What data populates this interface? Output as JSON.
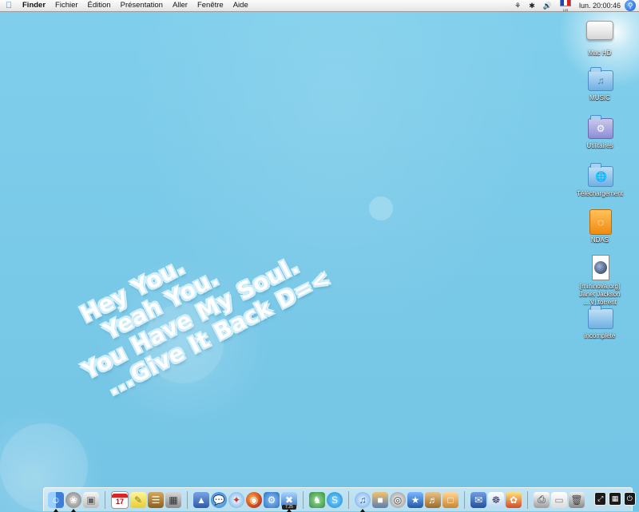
{
  "menubar": {
    "apple_glyph": "",
    "app_name": "Finder",
    "menus": [
      "Fichier",
      "Édition",
      "Présentation",
      "Aller",
      "Fenêtre",
      "Aide"
    ],
    "flag_label": "123",
    "clock": "lun. 20:00:46"
  },
  "desktop_icons": [
    {
      "label": "Mac HD",
      "icon": "hard-drive-icon"
    },
    {
      "label": "MUSIC",
      "icon": "music-folder-icon"
    },
    {
      "label": "Utilitaires",
      "icon": "utilities-folder-icon"
    },
    {
      "label": "Téléchargement",
      "icon": "download-folder-icon"
    },
    {
      "label": "NDAS",
      "icon": "ndas-drive-icon"
    },
    {
      "label": "[mininova.org] Janet Jackson ....V].torrent",
      "icon": "torrent-file-icon"
    },
    {
      "label": "incomplete",
      "icon": "folder-icon"
    }
  ],
  "wallpaper_text": [
    "Hey You.",
    "Yeah You.",
    "You Have My Soul.",
    "...Give It Back D=<"
  ],
  "dock": {
    "calendar_day": "17",
    "badge_text": "7.25",
    "groups": [
      [
        "finder-icon",
        "network-icon",
        "preview-icon"
      ],
      [
        "ical-icon",
        "stickies-icon",
        "notes-icon",
        "calculator-icon"
      ],
      [
        "photo-icon",
        "ichat-icon",
        "safari-icon",
        "firefox-icon",
        "cog-icon",
        "xcode-icon"
      ],
      [
        "messenger-icon",
        "skype-icon"
      ],
      [
        "itunes-icon",
        "iphoto-icon",
        "dvd-icon",
        "imovie-icon",
        "garageband-icon",
        "iweb-icon"
      ],
      [
        "mail-icon",
        "camino-icon",
        "popcorn-icon"
      ],
      [
        "printer-icon",
        "screen-icon",
        "trash-icon"
      ]
    ]
  },
  "colors": {
    "desktop": "#7ccbe9",
    "menu_bar": "#f0f0f0",
    "accent": "#2a6fd0"
  }
}
